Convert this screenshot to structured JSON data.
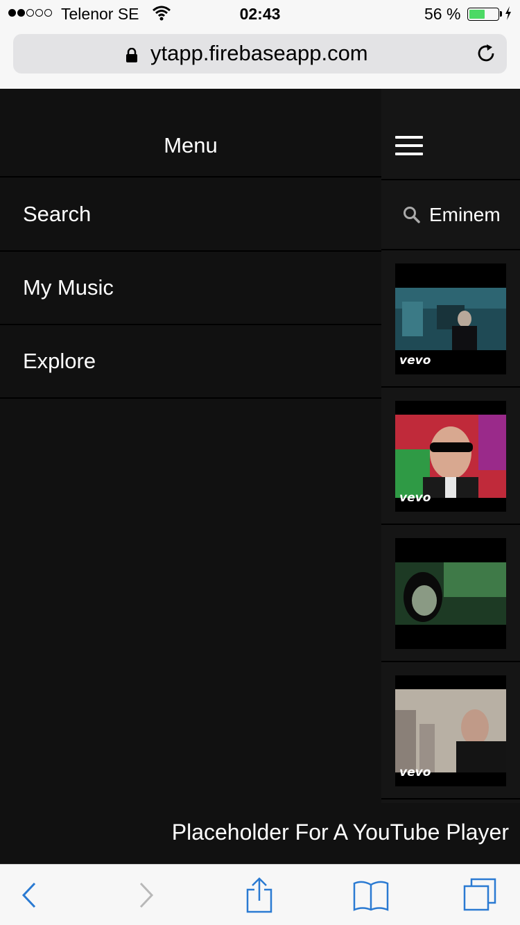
{
  "status_bar": {
    "carrier": "Telenor SE",
    "time": "02:43",
    "battery_percent": "56 %",
    "battery_level": 0.56,
    "signal_bars_filled": 2,
    "signal_bars_total": 5
  },
  "browser": {
    "url": "ytapp.firebaseapp.com"
  },
  "menu": {
    "title": "Menu",
    "items": [
      {
        "label": "Search"
      },
      {
        "label": "My Music"
      },
      {
        "label": "Explore"
      }
    ]
  },
  "main": {
    "search_query": "Eminem",
    "results": [
      {
        "badge": "vevo"
      },
      {
        "badge": "vevo"
      },
      {
        "badge": ""
      },
      {
        "badge": "vevo"
      }
    ]
  },
  "player": {
    "placeholder": "Placeholder For A YouTube Player"
  },
  "colors": {
    "background": "#111111",
    "accent": "#2a7ad2",
    "battery": "#4cd964"
  }
}
